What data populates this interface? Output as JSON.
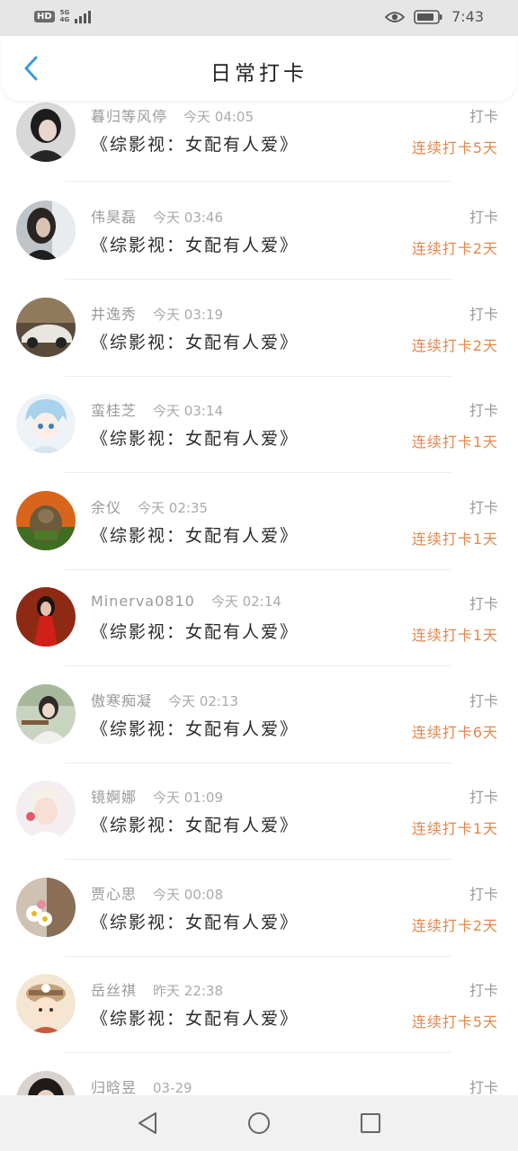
{
  "status_bar": {
    "network_badge": "HD",
    "network_type": "5G",
    "network_sub": "4G",
    "time": "7:43",
    "icons": [
      "eye-icon",
      "battery-icon",
      "signal-icon"
    ]
  },
  "header": {
    "title": "日常打卡",
    "back_icon": "chevron-left-icon",
    "accent_color": "#3a9be0"
  },
  "colors": {
    "streak": "#e5874a",
    "muted": "#9a9a9a",
    "text": "#2a2a2a"
  },
  "entries": [
    {
      "name": "暮归等风停",
      "time": "今天 04:05",
      "book": "《综影视：女配有人爱》",
      "tag": "打卡",
      "streak": "连续打卡5天",
      "avatar": "avatar-dark-hair-boy"
    },
    {
      "name": "伟昊磊",
      "time": "今天 03:46",
      "book": "《综影视：女配有人爱》",
      "tag": "打卡",
      "streak": "连续打卡2天",
      "avatar": "avatar-woman-dark"
    },
    {
      "name": "井逸秀",
      "time": "今天 03:19",
      "book": "《综影视：女配有人爱》",
      "tag": "打卡",
      "streak": "连续打卡2天",
      "avatar": "avatar-car"
    },
    {
      "name": "蛮桂芝",
      "time": "今天 03:14",
      "book": "《综影视：女配有人爱》",
      "tag": "打卡",
      "streak": "连续打卡1天",
      "avatar": "avatar-anime-boy"
    },
    {
      "name": "余仪",
      "time": "今天 02:35",
      "book": "《综影视：女配有人爱》",
      "tag": "打卡",
      "streak": "连续打卡1天",
      "avatar": "avatar-game-character"
    },
    {
      "name": "Minerva0810",
      "time": "今天 02:14",
      "book": "《综影视：女配有人爱》",
      "tag": "打卡",
      "streak": "连续打卡1天",
      "avatar": "avatar-woman-red"
    },
    {
      "name": "傲寒痴凝",
      "time": "今天 02:13",
      "book": "《综影视：女配有人爱》",
      "tag": "打卡",
      "streak": "连续打卡6天",
      "avatar": "avatar-girl-photo"
    },
    {
      "name": "镜婀娜",
      "time": "今天 01:09",
      "book": "《综影视：女配有人爱》",
      "tag": "打卡",
      "streak": "连续打卡1天",
      "avatar": "avatar-boy-light"
    },
    {
      "name": "贾心思",
      "time": "今天 00:08",
      "book": "《综影视：女配有人爱》",
      "tag": "打卡",
      "streak": "连续打卡2天",
      "avatar": "avatar-flowers"
    },
    {
      "name": "岳丝祺",
      "time": "昨天 22:38",
      "book": "《综影视：女配有人爱》",
      "tag": "打卡",
      "streak": "连续打卡5天",
      "avatar": "avatar-cartoon-hat"
    },
    {
      "name": "归晗昱",
      "time": "03-29",
      "book": "",
      "tag": "打卡",
      "streak": "",
      "avatar": "avatar-dark-hair"
    }
  ],
  "nav_bar": {
    "back": "triangle-back-icon",
    "home": "circle-home-icon",
    "recents": "square-recents-icon"
  }
}
